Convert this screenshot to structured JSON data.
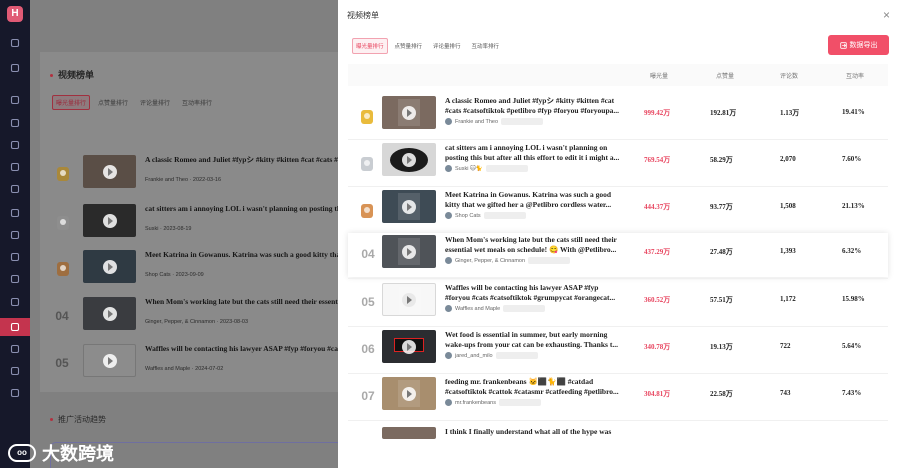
{
  "sidebar": {
    "logo_letter": "H",
    "icons": [
      "dashboard-icon",
      "box-icon",
      "user-icon",
      "chart-icon",
      "list-icon",
      "grid-icon",
      "file-icon",
      "bell-icon",
      "tag-icon",
      "cube-icon",
      "wallet-icon",
      "settings-icon",
      "crown-icon",
      "user-plus-icon",
      "person-icon",
      "star-icon"
    ]
  },
  "background": {
    "section_title": "视频榜单",
    "tabs": [
      "曝光量排行",
      "点赞量排行",
      "评论量排行",
      "互动率排行"
    ],
    "active_tab": 0,
    "rows": [
      {
        "title": "A classic Romeo and Juliet #fypシ #kitty #kitten #cat #cats #catsoftiktok #petlibro #fyp #foryou #foryoupa...",
        "meta": "Frankie and Theo  ·  2022-03-16"
      },
      {
        "title": "cat sitters am i annoying LOL i wasn't planning on posting this but after all this effort to edit it i might a...",
        "meta": "Suski  ·  2023-08-19"
      },
      {
        "title": "Meet Katrina in Gowanus. Katrina was such a good kitty that we gifted her a @Petlibro cordless wate...",
        "meta": "Shop Cats  ·  2023-09-09"
      },
      {
        "title": "When Mom's working late but the cats still need their essential wet meals on schedule! 😋 With @Petlibro...",
        "meta": "Ginger, Pepper, & Cinnamon  ·  2023-08-03"
      },
      {
        "title": "Waffles will be contacting his lawyer ASAP #fyp #foryou #cats #catsoftiktok #grumpycat #orangecat...",
        "meta": "Waffles and Maple  ·  2024-07-02"
      }
    ],
    "bottom_title": "推广活动趋势",
    "watermark": "大数跨境"
  },
  "modal": {
    "title": "视频榜单",
    "close_label": "×",
    "tabs": [
      "曝光量排行",
      "点赞量排行",
      "评论量排行",
      "互动率排行"
    ],
    "active_tab": 0,
    "export_label": "数据导出",
    "columns": {
      "exposure": "曝光量",
      "likes": "点赞量",
      "comments": "评论数",
      "rate": "互动率"
    },
    "rows": [
      {
        "rank": "",
        "medal": "gold",
        "thumb": "t1",
        "title": "A classic Romeo and Juliet #fypシ #kitty #kitten #cat #cats #catsoftiktok #petlibro #fyp #foryou #foryoupa...",
        "author": "Frankie and Theo",
        "exposure": "999.42万",
        "likes": "192.81万",
        "comments": "1.13万",
        "rate": "19.41%"
      },
      {
        "rank": "",
        "medal": "silver",
        "thumb": "t2",
        "title": "cat sitters am i annoying LOL i wasn't planning on posting this but after all this effort to edit it i might a...",
        "author": "Suski 🐱🐈",
        "exposure": "769.54万",
        "likes": "58.29万",
        "comments": "2,070",
        "rate": "7.60%"
      },
      {
        "rank": "",
        "medal": "bronze",
        "thumb": "t3",
        "title": "Meet Katrina in Gowanus. Katrina was such a good kitty that we gifted her a @Petlibro cordless water...",
        "author": "Shop Cats",
        "exposure": "444.37万",
        "likes": "93.77万",
        "comments": "1,508",
        "rate": "21.13%"
      },
      {
        "rank": "04",
        "medal": "",
        "thumb": "t4",
        "title": "When Mom's working late but the cats still need their essential wet meals on schedule! 😋 With @Petlibro...",
        "author": "Ginger, Pepper, & Cinnamon",
        "exposure": "437.29万",
        "likes": "27.48万",
        "comments": "1,393",
        "rate": "6.32%"
      },
      {
        "rank": "05",
        "medal": "",
        "thumb": "t5",
        "title": "Waffles will be contacting his lawyer ASAP #fyp #foryou #cats #catsoftiktok #grumpycat #orangecat...",
        "author": "Waffles and Maple",
        "exposure": "360.52万",
        "likes": "57.51万",
        "comments": "1,172",
        "rate": "15.98%"
      },
      {
        "rank": "06",
        "medal": "",
        "thumb": "t6",
        "title": "Wet food is essential in summer, but early morning wake-ups from your cat can be exhausting. Thanks t...",
        "author": "jared_and_milo",
        "exposure": "340.78万",
        "likes": "19.13万",
        "comments": "722",
        "rate": "5.64%"
      },
      {
        "rank": "07",
        "medal": "",
        "thumb": "t7",
        "title": "feeding mr. frankenbeans 🐱⬛🐈⬛ #catdad #catsoftiktok #cattok #catasmr #catfeeding #petlibro...",
        "author": "mr.frankenbeans",
        "exposure": "304.81万",
        "likes": "22.58万",
        "comments": "743",
        "rate": "7.43%"
      },
      {
        "rank": "",
        "medal": "",
        "thumb": "t1",
        "title": "I think I finally understand what all of the hype was",
        "author": "",
        "exposure": "",
        "likes": "",
        "comments": "",
        "rate": ""
      }
    ]
  },
  "colors": {
    "accent": "#f14f68",
    "sidebar": "#16182a",
    "gold": "#e9bb3c",
    "silver": "#c9cdd2",
    "bronze": "#d89355"
  }
}
